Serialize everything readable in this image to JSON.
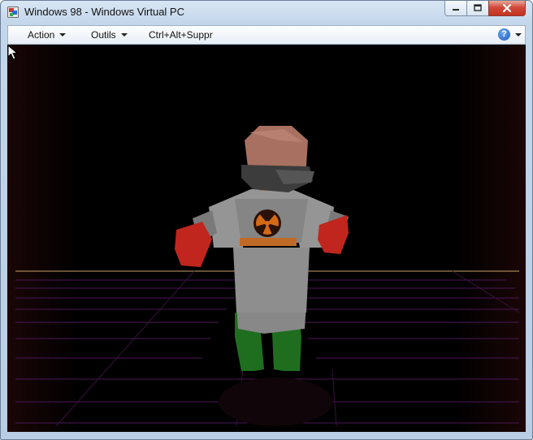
{
  "window": {
    "title": "Windows 98 - Windows Virtual PC",
    "icons": {
      "app": "virtual-pc-icon",
      "minimize": "minimize-icon",
      "maximize": "maximize-icon",
      "close": "close-icon"
    }
  },
  "menubar": {
    "items": [
      {
        "label": "Action",
        "has_dropdown": true
      },
      {
        "label": "Outils",
        "has_dropdown": true
      },
      {
        "label": "Ctrl+Alt+Suppr",
        "has_dropdown": false
      }
    ],
    "help_icon": "help-icon",
    "help_glyph": "?"
  },
  "vm_screen": {
    "content": "3d-game-scene",
    "character": "armored-character",
    "pointer": "mouse-cursor",
    "colors": {
      "background": "#000000",
      "floor_grid": "#5a1a6a",
      "horizon": "#c9a26a",
      "armor": "#8a8a8a",
      "gloves": "#c0261e",
      "legs": "#1f6e1f",
      "head": "#b07868",
      "emblem": "#d46a16"
    }
  }
}
